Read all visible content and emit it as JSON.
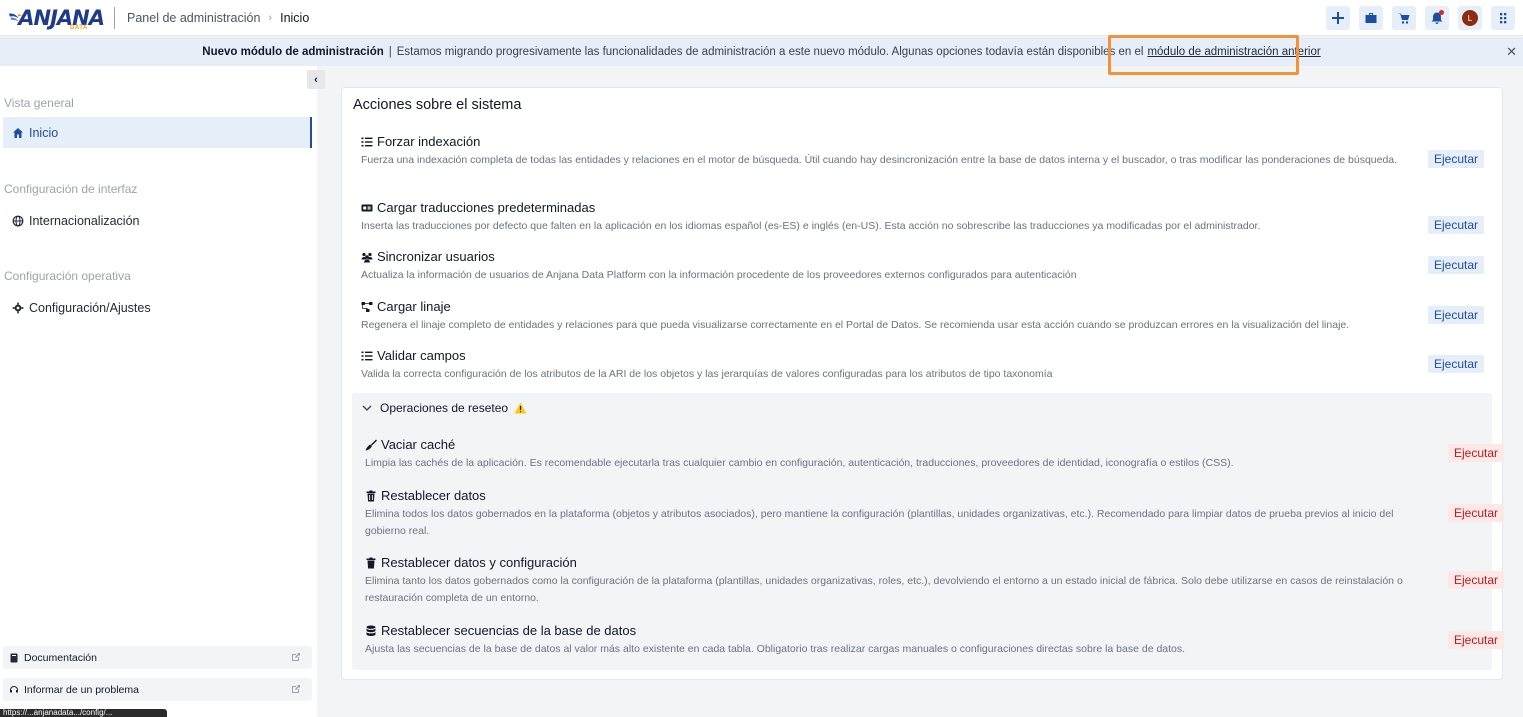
{
  "header": {
    "logo_text": "ANJANA",
    "logo_sub": "DATA",
    "breadcrumb_root": "Panel de administración",
    "breadcrumb_sep": "›",
    "breadcrumb_current": "Inicio",
    "avatar_initial": "L"
  },
  "banner": {
    "title": "Nuevo módulo de administración",
    "separator": "|",
    "text": "Estamos migrando progresivamente las funcionalidades de administración a este nuevo módulo. Algunas opciones todavía están disponibles en el",
    "link": "módulo de administración anterior",
    "close": "✕"
  },
  "sidebar": {
    "collapse": "‹",
    "sections": [
      {
        "title": "Vista general",
        "items": [
          {
            "label": "Inicio",
            "icon": "home-icon"
          }
        ]
      },
      {
        "title": "Configuración de interfaz",
        "items": [
          {
            "label": "Internacionalización",
            "icon": "globe-icon"
          }
        ]
      },
      {
        "title": "Configuración operativa",
        "items": [
          {
            "label": "Configuración/Ajustes",
            "icon": "gear-icon"
          }
        ]
      }
    ],
    "footer": [
      {
        "label": "Documentación",
        "icon": "book-icon"
      },
      {
        "label": "Informar de un problema",
        "icon": "headset-icon"
      }
    ],
    "url_tooltip": "https://...anjanadata.../config/..."
  },
  "main": {
    "title": "Acciones sobre el sistema",
    "exec_label": "Ejecutar",
    "actions": [
      {
        "title": "Forzar indexación",
        "icon": "list-icon",
        "desc": "Fuerza una indexación completa de todas las entidades y relaciones en el motor de búsqueda. Útil cuando hay desincronización entre la base de datos interna y el buscador, o tras modificar las ponderaciones de búsqueda."
      },
      {
        "title": "Cargar traducciones predeterminadas",
        "icon": "language-icon",
        "desc": "Inserta las traducciones por defecto que falten en la aplicación en los idiomas español (es-ES) e inglés (en-US). Esta acción no sobrescribe las traducciones ya modificadas por el administrador."
      },
      {
        "title": "Sincronizar usuarios",
        "icon": "users-icon",
        "desc": "Actualiza la información de usuarios de Anjana Data Platform con la información procedente de los proveedores externos configurados para autenticación"
      },
      {
        "title": "Cargar linaje",
        "icon": "lineage-icon",
        "desc": "Regenera el linaje completo de entidades y relaciones para que pueda visualizarse correctamente en el Portal de Datos. Se recomienda usar esta acción cuando se produzcan errores en la visualización del linaje."
      },
      {
        "title": "Validar campos",
        "icon": "list-check-icon",
        "desc": "Valida la correcta configuración de los atributos de la ARI de los objetos y las jerarquías de valores configuradas para los atributos de tipo taxonomía"
      }
    ],
    "reset": {
      "title": "Operaciones de reseteo",
      "actions": [
        {
          "title": "Vaciar caché",
          "icon": "broom-icon",
          "desc": "Limpia las cachés de la aplicación. Es recomendable ejecutarla tras cualquier cambio en configuración, autenticación, traducciones, proveedores de identidad, iconografía o estilos (CSS)."
        },
        {
          "title": "Restablecer datos",
          "icon": "trash-icon",
          "desc": "Elimina todos los datos gobernados en la plataforma (objetos y atributos asociados), pero mantiene la configuración (plantillas, unidades organizativas, etc.). Recomendado para limpiar datos de prueba previos al inicio del gobierno real."
        },
        {
          "title": "Restablecer datos y configuración",
          "icon": "trash-full-icon",
          "desc": "Elimina tanto los datos gobernados como la configuración de la plataforma (plantillas, unidades organizativas, roles, etc.), devolviendo el entorno a un estado inicial de fábrica. Solo debe utilizarse en casos de reinstalación o restauración completa de un entorno."
        },
        {
          "title": "Restablecer secuencias de la base de datos",
          "icon": "database-icon",
          "desc": "Ajusta las secuencias de la base de datos al valor más alto existente en cada tabla. Obligatorio tras realizar cargas manuales o configuraciones directas sobre la base de datos."
        }
      ]
    }
  }
}
